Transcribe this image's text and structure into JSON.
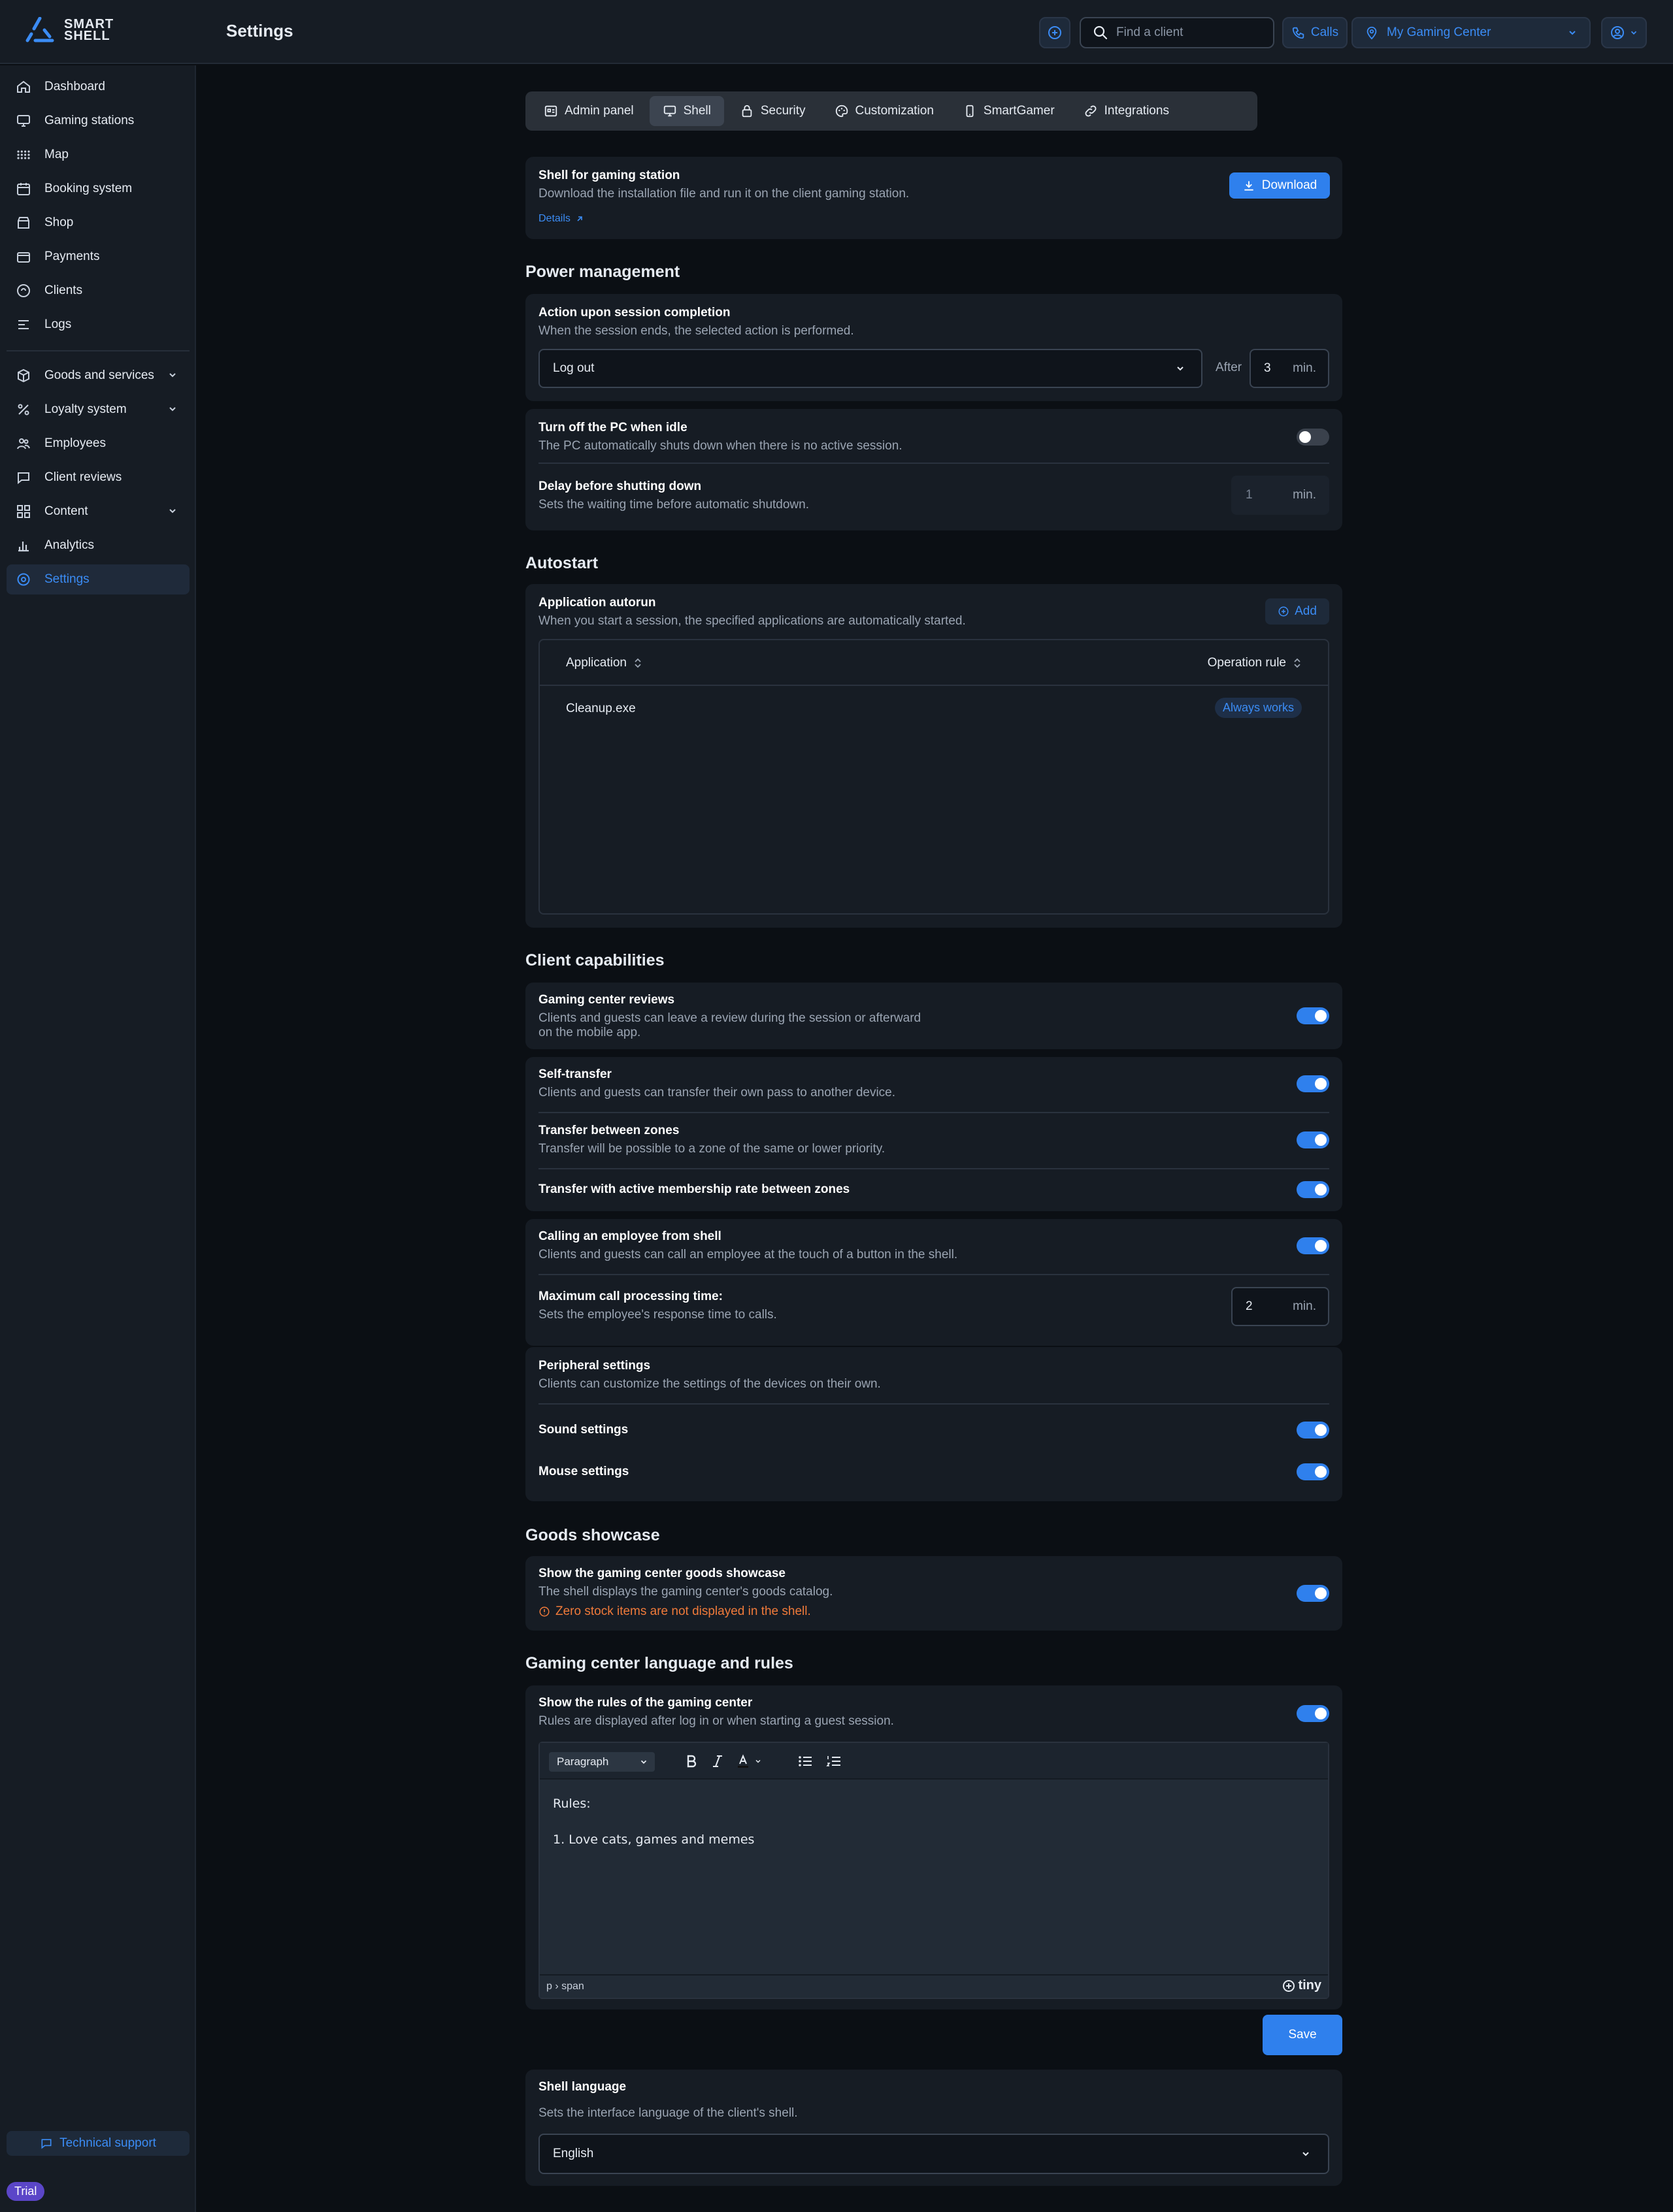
{
  "header": {
    "logo_line1": "SMART",
    "logo_line2": "SHELL",
    "page_title": "Settings",
    "search_placeholder": "Find a client",
    "calls_label": "Calls",
    "center_label": "My Gaming Center"
  },
  "sidebar": {
    "items": [
      {
        "label": "Dashboard",
        "icon": "home-icon"
      },
      {
        "label": "Gaming stations",
        "icon": "monitor-icon"
      },
      {
        "label": "Map",
        "icon": "grid-dots-icon"
      },
      {
        "label": "Booking system",
        "icon": "calendar-icon"
      },
      {
        "label": "Shop",
        "icon": "store-icon"
      },
      {
        "label": "Payments",
        "icon": "wallet-icon"
      },
      {
        "label": "Clients",
        "icon": "user-icon"
      },
      {
        "label": "Logs",
        "icon": "list-icon"
      }
    ],
    "groups": [
      {
        "label": "Goods and services",
        "icon": "box-icon"
      },
      {
        "label": "Loyalty system",
        "icon": "percent-icon"
      },
      {
        "label": "Employees",
        "icon": "users-icon"
      },
      {
        "label": "Client reviews",
        "icon": "chat-icon"
      },
      {
        "label": "Content",
        "icon": "layout-icon"
      },
      {
        "label": "Analytics",
        "icon": "bar-chart-icon"
      },
      {
        "label": "Settings",
        "icon": "gear-icon"
      }
    ],
    "support_label": "Technical support",
    "trial_label": "Trial"
  },
  "tabs": [
    "Admin panel",
    "Shell",
    "Security",
    "Customization",
    "SmartGamer",
    "Integrations"
  ],
  "shell_card": {
    "title": "Shell for gaming station",
    "desc": "Download the installation file and run it on the client gaming station.",
    "details": "Details",
    "download": "Download"
  },
  "power": {
    "heading": "Power management",
    "action_title": "Action upon session completion",
    "action_desc": "When the session ends, the selected action is performed.",
    "action_value": "Log out",
    "after_label": "After",
    "after_value": "3",
    "min": "min.",
    "idle_title": "Turn off the PC when idle",
    "idle_desc": "The PC automatically shuts down when there is no active session.",
    "delay_title": "Delay before shutting down",
    "delay_desc": "Sets the waiting time before automatic shutdown.",
    "delay_value": "1"
  },
  "autostart": {
    "heading": "Autostart",
    "title": "Application autorun",
    "desc": "When you start a session, the specified applications are automatically started.",
    "add": "Add",
    "col_app": "Application",
    "col_rule": "Operation rule",
    "rows": [
      {
        "app": "Cleanup.exe",
        "rule": "Always works"
      }
    ]
  },
  "capabilities": {
    "heading": "Client capabilities",
    "reviews_title": "Gaming center reviews",
    "reviews_desc1": "Clients and guests can leave a review during the session or afterward",
    "reviews_desc2": "on the mobile app.",
    "self_title": "Self-transfer",
    "self_desc": "Clients and guests can transfer their own pass to another device.",
    "zones_title": "Transfer between zones",
    "zones_desc": "Transfer will be possible to a zone of the same or lower priority.",
    "membership_title": "Transfer with active membership rate between zones",
    "call_title": "Calling an employee from shell",
    "call_desc": "Clients and guests can call an employee at the touch of a button in the shell.",
    "maxcall_title": "Maximum call processing time:",
    "maxcall_desc": "Sets the employee's response time to calls.",
    "maxcall_value": "2",
    "periph_title": "Peripheral settings",
    "periph_desc": "Clients can customize the settings of the devices on their own.",
    "sound_title": "Sound settings",
    "mouse_title": "Mouse settings"
  },
  "goods": {
    "heading": "Goods showcase",
    "title": "Show the gaming center goods showcase",
    "desc": "The shell displays the gaming center's goods catalog.",
    "warning": "Zero stock items are not displayed in the shell."
  },
  "rules": {
    "heading": "Gaming center language and rules",
    "title": "Show the rules of the gaming center",
    "desc": "Rules are displayed after log in or when starting a guest session.",
    "paragraph": "Paragraph",
    "line1": "Rules:",
    "line2": "1. Love cats, games and memes",
    "path": "p › span",
    "tiny": "tiny",
    "save": "Save"
  },
  "language": {
    "title": "Shell language",
    "desc": "Sets the interface language of the client's shell.",
    "value": "English"
  },
  "colors": {
    "accent": "#2f80ed",
    "warning": "#f07a3a",
    "trial": "#5b46c8"
  }
}
